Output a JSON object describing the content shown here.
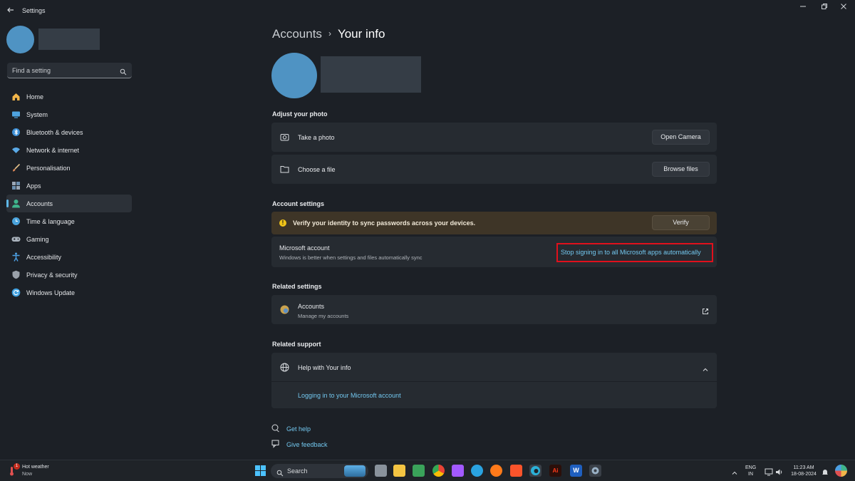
{
  "window": {
    "title": "Settings"
  },
  "sidebar": {
    "search_placeholder": "Find a setting",
    "items": [
      {
        "label": "Home",
        "icon": "home-icon",
        "color": "#f2b54a"
      },
      {
        "label": "System",
        "icon": "system-icon",
        "color": "#4ea3e0"
      },
      {
        "label": "Bluetooth & devices",
        "icon": "bluetooth-icon",
        "color": "#3d8fd6"
      },
      {
        "label": "Network & internet",
        "icon": "wifi-icon",
        "color": "#5aa9e6"
      },
      {
        "label": "Personalisation",
        "icon": "brush-icon",
        "color": "#e28b5a"
      },
      {
        "label": "Apps",
        "icon": "apps-icon",
        "color": "#9aa7b6"
      },
      {
        "label": "Accounts",
        "icon": "person-icon",
        "color": "#3fb58c"
      },
      {
        "label": "Time & language",
        "icon": "clock-globe-icon",
        "color": "#4aa3dc"
      },
      {
        "label": "Gaming",
        "icon": "controller-icon",
        "color": "#a9b2bc"
      },
      {
        "label": "Accessibility",
        "icon": "accessibility-icon",
        "color": "#4c9fe2"
      },
      {
        "label": "Privacy & security",
        "icon": "shield-icon",
        "color": "#9aa1aa"
      },
      {
        "label": "Windows Update",
        "icon": "update-icon",
        "color": "#3ea0e0"
      }
    ],
    "selected": "Accounts"
  },
  "breadcrumb": {
    "parent": "Accounts",
    "separator": "›",
    "current": "Your info"
  },
  "photo": {
    "heading": "Adjust your photo",
    "take_photo": {
      "label": "Take a photo",
      "button": "Open Camera"
    },
    "choose_file": {
      "label": "Choose a file",
      "button": "Browse files"
    }
  },
  "account_settings": {
    "heading": "Account settings",
    "warning": {
      "text": "Verify your identity to sync passwords across your devices.",
      "button": "Verify"
    },
    "microsoft_account": {
      "title": "Microsoft account",
      "subtitle": "Windows is better when settings and files automatically sync",
      "link": "Stop signing in to all Microsoft apps automatically"
    }
  },
  "related_settings": {
    "heading": "Related settings",
    "accounts": {
      "title": "Accounts",
      "subtitle": "Manage my accounts"
    }
  },
  "related_support": {
    "heading": "Related support",
    "help": {
      "title": "Help with Your info",
      "link": "Logging in to your Microsoft account"
    }
  },
  "footer": {
    "get_help": "Get help",
    "give_feedback": "Give feedback"
  },
  "taskbar": {
    "weather": {
      "title": "Hot weather",
      "subtitle": "Now",
      "badge": "1"
    },
    "search_label": "Search",
    "tray": {
      "lang1": "ENG",
      "lang2": "IN",
      "time": "11:23 AM",
      "date": "18-08-2024"
    }
  },
  "colors": {
    "accent": "#73c8f0",
    "highlight_box": "#e0101c",
    "warning_bg": "#3e3527"
  }
}
